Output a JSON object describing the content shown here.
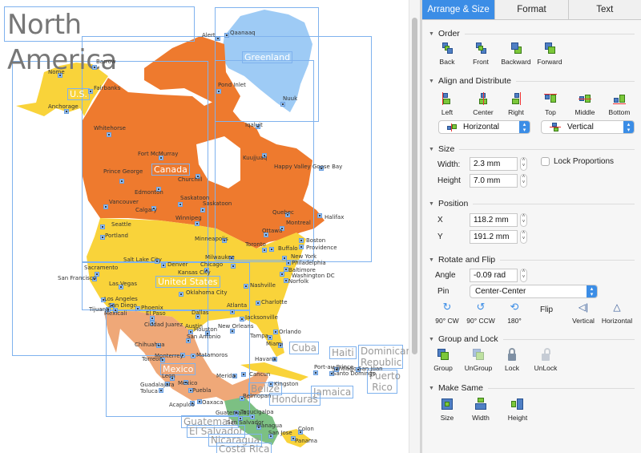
{
  "canvas": {
    "title": "North America",
    "countries_white": [
      {
        "key": "us_alaska",
        "label": "U.S."
      },
      {
        "key": "greenland",
        "label": "Greenland"
      },
      {
        "key": "canada",
        "label": "Canada"
      },
      {
        "key": "united_states",
        "label": "United States"
      },
      {
        "key": "mexico",
        "label": "Mexico"
      }
    ],
    "countries_grey": [
      {
        "key": "cuba",
        "label": "Cuba"
      },
      {
        "key": "haiti",
        "label": "Haiti"
      },
      {
        "key": "dominican_republic",
        "label": "Dominican Republic"
      },
      {
        "key": "puerto_rico",
        "label": "Puerto Rico"
      },
      {
        "key": "jamaica",
        "label": "Jamaica"
      },
      {
        "key": "belize",
        "label": "Belize"
      },
      {
        "key": "honduras",
        "label": "Honduras"
      },
      {
        "key": "guatemala",
        "label": "Guatemala"
      },
      {
        "key": "el_salvador",
        "label": "El Salvador"
      },
      {
        "key": "nicaragua",
        "label": "Nicaragua"
      },
      {
        "key": "costa_rica",
        "label": "Costa Rica"
      }
    ],
    "cities": [
      "Barrow",
      "Nome",
      "Fairbanks",
      "Anchorage",
      "Alert",
      "Qaanaaq",
      "Pond Inlet",
      "Nuuk",
      "Iqaluit",
      "Whitehorse",
      "Fort McMurray",
      "Prince George",
      "Churchill",
      "Kuujjuaq",
      "Happy Valley Goose Bay",
      "Edmonton",
      "Vancouver",
      "Calgary",
      "Saskatoon",
      "Saskatoon",
      "Winnipeg",
      "Quebec",
      "Montreal",
      "Halifax",
      "Seattle",
      "Portland",
      "Ottawa",
      "Minneapolis",
      "Toronto",
      "Buffalo",
      "Boston",
      "Providence",
      "Milwaukee",
      "New York",
      "Salt Lake City",
      "Denver",
      "Chicago",
      "Philadelphia",
      "Sacramento",
      "Kansas City",
      "Baltimore",
      "San Francisco",
      "Washington DC",
      "Norfolk",
      "Las Vegas",
      "Nashville",
      "Oklahoma City",
      "Los Angeles",
      "Charlotte",
      "San Diego",
      "Phoenix",
      "Tijuana",
      "Mexicali",
      "Atlanta",
      "El Paso",
      "Dallas",
      "Ciudad Juarez",
      "Jacksonville",
      "Austin",
      "Houston",
      "New Orleans",
      "Orlando",
      "San Antonio",
      "Tampa",
      "Chihuahua",
      "Miami",
      "Monterrey",
      "Matamoros",
      "Havana",
      "Torreon",
      "Cancun",
      "Merida",
      "Leon",
      "Guadalajara",
      "Mexico",
      "Toluca",
      "Puebla",
      "Oaxaca",
      "Acapulco",
      "Belmopan",
      "Guatemala",
      "Tegucigalpa",
      "San Salvador",
      "Managua",
      "San Jose",
      "Colon",
      "Panama",
      "Port-au-Prince",
      "Santo Domingo",
      "Santiago",
      "San Juan",
      "Kingston"
    ]
  },
  "panel": {
    "tabs": [
      {
        "label": "Arrange & Size",
        "active": true
      },
      {
        "label": "Format",
        "active": false
      },
      {
        "label": "Text",
        "active": false
      }
    ],
    "order": {
      "title": "Order",
      "buttons": [
        "Back",
        "Front",
        "Backward",
        "Forward"
      ]
    },
    "align": {
      "title": "Align and Distribute",
      "buttons": [
        "Left",
        "Center",
        "Right",
        "Top",
        "Middle",
        "Bottom"
      ],
      "horizontal_select": "Horizontal",
      "vertical_select": "Vertical"
    },
    "size": {
      "title": "Size",
      "width_label": "Width:",
      "width_value": "2.3 mm",
      "height_label": "Height",
      "height_value": "7.0 mm",
      "lock_label": "Lock Proportions",
      "lock_checked": false
    },
    "position": {
      "title": "Position",
      "x_label": "X",
      "x_value": "118.2 mm",
      "y_label": "Y",
      "y_value": "191.2 mm"
    },
    "rotate": {
      "title": "Rotate and Flip",
      "angle_label": "Angle",
      "angle_value": "-0.09 rad",
      "pin_label": "Pin",
      "pin_value": "Center-Center",
      "buttons": [
        "90° CW",
        "90° CCW",
        "180°"
      ],
      "flip_label": "Flip",
      "flip_buttons": [
        "Vertical",
        "Horizontal"
      ]
    },
    "group": {
      "title": "Group and Lock",
      "buttons": [
        "Group",
        "UnGroup",
        "Lock",
        "UnLock"
      ]
    },
    "same": {
      "title": "Make Same",
      "buttons": [
        "Size",
        "Width",
        "Height"
      ]
    },
    "colors": {
      "accent": "#3b8de6",
      "canada": "#ee7a2e",
      "usa": "#f9d33a",
      "mexico": "#efa878",
      "greenland": "#9ecbf5",
      "central_america": "#7cc083",
      "selection": "#7fb2ee"
    }
  }
}
